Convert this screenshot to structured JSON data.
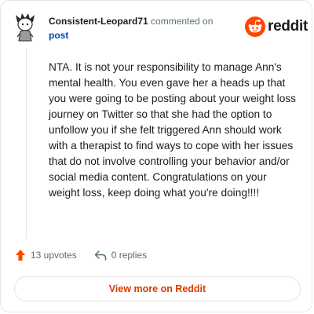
{
  "comment": {
    "username": "Consistent-Leopard71",
    "commented_on": "commented on",
    "post_link": "post",
    "body": "NTA. It is not your responsibility to manage Ann's mental health. You even gave her a heads up that you were going to be posting about your weight loss journey on Twitter so that she had the option to unfollow you if she felt triggered Ann should work with a therapist to find ways to cope with her issues that do not involve controlling your behavior and/or social media content. Congratulations on your weight loss, keep doing what you're doing!!!!"
  },
  "brand": {
    "name": "reddit",
    "logo_icon": "reddit-snoo-icon",
    "accent": "#ff4500"
  },
  "actions": {
    "upvotes": "13 upvotes",
    "upvote_icon": "upvote-arrow-icon",
    "upvote_color": "#ff4500",
    "replies": "0 replies",
    "reply_icon": "reply-arrow-icon"
  },
  "footer": {
    "view_button": "View more on Reddit",
    "button_color": "#d93a00"
  }
}
